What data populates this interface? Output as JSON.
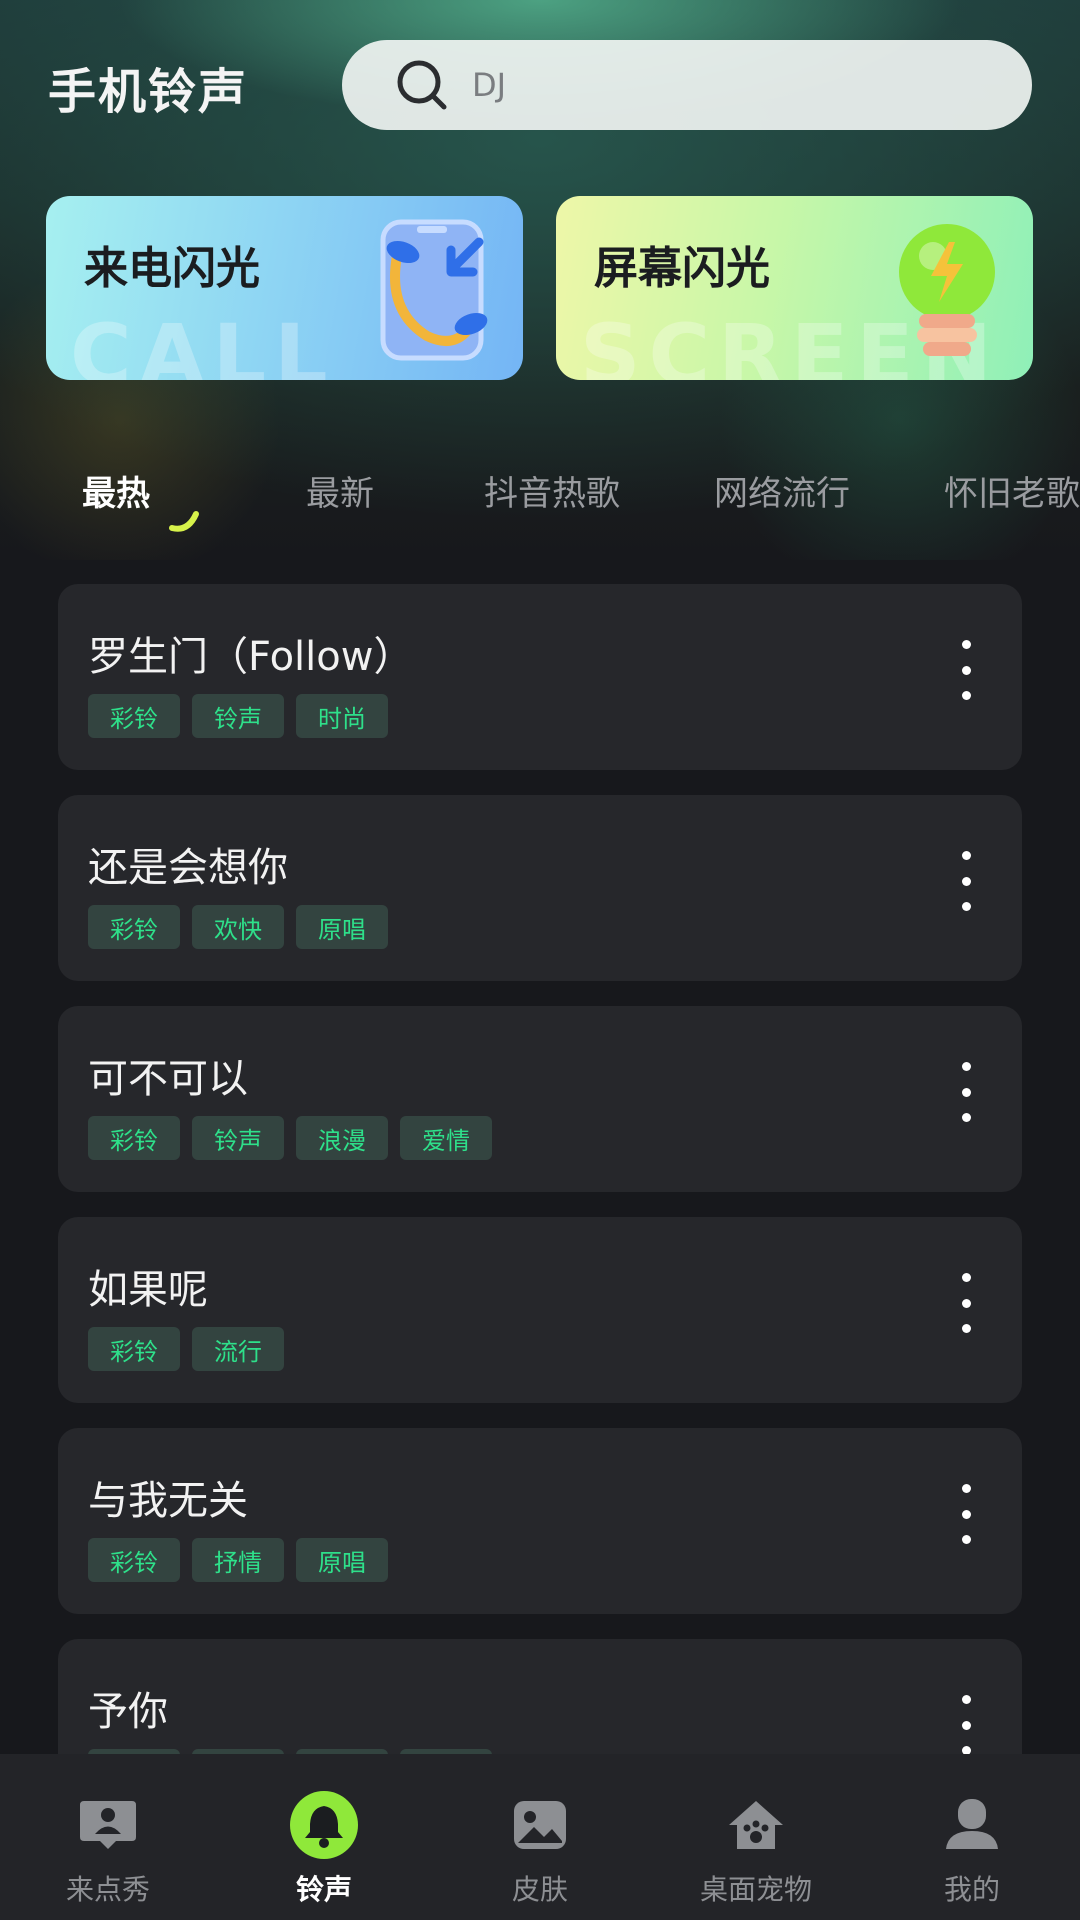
{
  "header": {
    "title": "手机铃声",
    "search_value": "DJ"
  },
  "feature_cards": [
    {
      "label": "来电闪光",
      "watermark": "CALL"
    },
    {
      "label": "屏幕闪光",
      "watermark": "SCREEN"
    }
  ],
  "tabs": [
    {
      "label": "最热",
      "active": true
    },
    {
      "label": "最新"
    },
    {
      "label": "抖音热歌"
    },
    {
      "label": "网络流行"
    },
    {
      "label": "怀旧老歌"
    }
  ],
  "songs": [
    {
      "title": "罗生门（Follow）",
      "tags": [
        "彩铃",
        "铃声",
        "时尚"
      ]
    },
    {
      "title": "还是会想你",
      "tags": [
        "彩铃",
        "欢快",
        "原唱"
      ]
    },
    {
      "title": "可不可以",
      "tags": [
        "彩铃",
        "铃声",
        "浪漫",
        "爱情"
      ]
    },
    {
      "title": "如果呢",
      "tags": [
        "彩铃",
        "流行"
      ]
    },
    {
      "title": "与我无关",
      "tags": [
        "彩铃",
        "抒情",
        "原唱"
      ]
    },
    {
      "title": "予你",
      "tags": []
    }
  ],
  "bottom_nav": [
    {
      "label": "来点秀",
      "icon": "profile-card-icon"
    },
    {
      "label": "铃声",
      "icon": "bell-icon",
      "active": true
    },
    {
      "label": "皮肤",
      "icon": "image-icon"
    },
    {
      "label": "桌面宠物",
      "icon": "pet-house-icon"
    },
    {
      "label": "我的",
      "icon": "person-icon"
    }
  ],
  "colors": {
    "accent_green": "#2ee08a",
    "tab_indicator": "#d7f24a",
    "card_bg": "#26272b",
    "page_bg": "#17181c"
  }
}
